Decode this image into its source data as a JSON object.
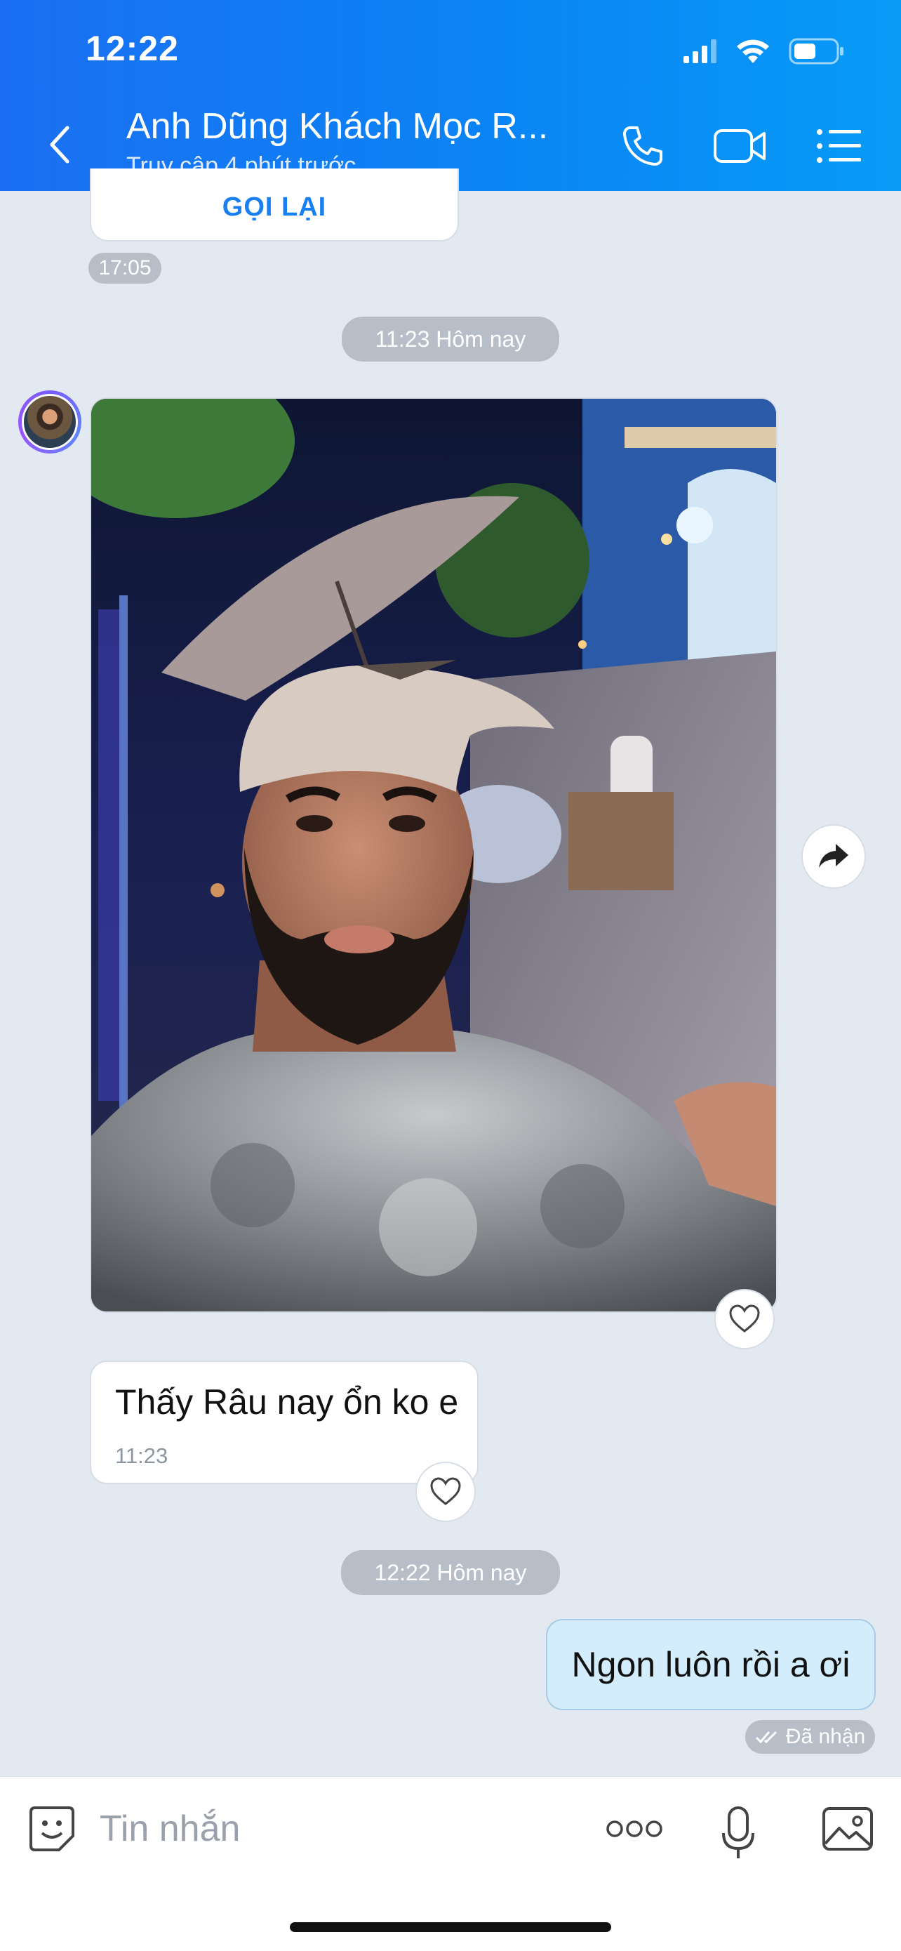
{
  "status_bar": {
    "time": "12:22"
  },
  "header": {
    "title": "Anh Dũng Khách Mọc R...",
    "subtitle": "Truy cập 4 phút trước"
  },
  "conversation": {
    "call_card": {
      "action_label": "GỌI LẠI",
      "time": "17:05"
    },
    "divider_1": "11:23 Hôm nay",
    "incoming_text": {
      "text": "Thấy Râu nay ổn ko e",
      "time": "11:23"
    },
    "divider_2": "12:22 Hôm nay",
    "outgoing_text": {
      "text": "Ngon luôn rồi a ơi",
      "status": "Đã nhận"
    }
  },
  "input": {
    "placeholder": "Tin nhắn"
  },
  "colors": {
    "header_start": "#1b6ff2",
    "header_end": "#079bf6",
    "accent": "#1a7ff0",
    "outgoing_bubble": "#d4edfc"
  }
}
